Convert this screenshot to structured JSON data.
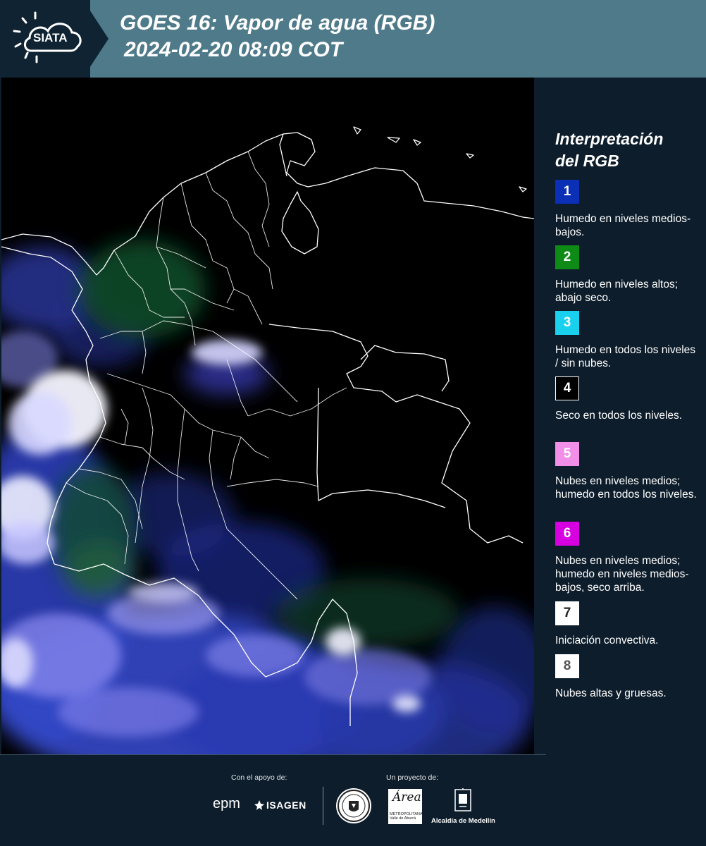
{
  "header": {
    "logo_text": "SIATA",
    "title_line1": "GOES 16: Vapor de agua (RGB)",
    "title_line2": "2024-02-20 08:09 COT"
  },
  "map": {
    "product": "GOES 16 water vapor RGB",
    "background_color": "#000000",
    "border_color": "#ffffff"
  },
  "legend": {
    "title_line1": "Interpretación",
    "title_line2": "del RGB",
    "items": [
      {
        "number": "1",
        "color": "#0b2fb5",
        "text_color": "#ffffff",
        "label": "Humedo en niveles medios-bajos."
      },
      {
        "number": "2",
        "color": "#0e8a16",
        "text_color": "#ffffff",
        "label": "Humedo en niveles altos; abajo seco."
      },
      {
        "number": "3",
        "color": "#19d0ee",
        "text_color": "#ffffff",
        "label": "Humedo en todos los niveles / sin nubes."
      },
      {
        "number": "4",
        "color": "#000000",
        "text_color": "#ffffff",
        "label": "Seco en todos los niveles."
      },
      {
        "number": "5",
        "color": "#f08ee8",
        "text_color": "#ffffff",
        "label": "Nubes en niveles medios; humedo en todos los niveles."
      },
      {
        "number": "6",
        "color": "#d600e0",
        "text_color": "#ffffff",
        "label": "Nubes en niveles medios; humedo en niveles medios-bajos, seco arriba."
      },
      {
        "number": "7",
        "color": "#ffffff",
        "text_color": "#222222",
        "label": "Iniciación convectiva."
      },
      {
        "number": "8",
        "color": "#ffffff",
        "text_color": "#555555",
        "label": "Nubes altas y gruesas."
      }
    ]
  },
  "footer": {
    "support_label": "Con el apoyo de:",
    "project_label": "Un proyecto de:",
    "epm": "epm",
    "isagen": "ISAGEN",
    "area_script": "Área",
    "area_sub_line1": "METROPOLITANA",
    "area_sub_line2": "Valle de Aburrá",
    "medellin": "Alcaldía de Medellín"
  }
}
